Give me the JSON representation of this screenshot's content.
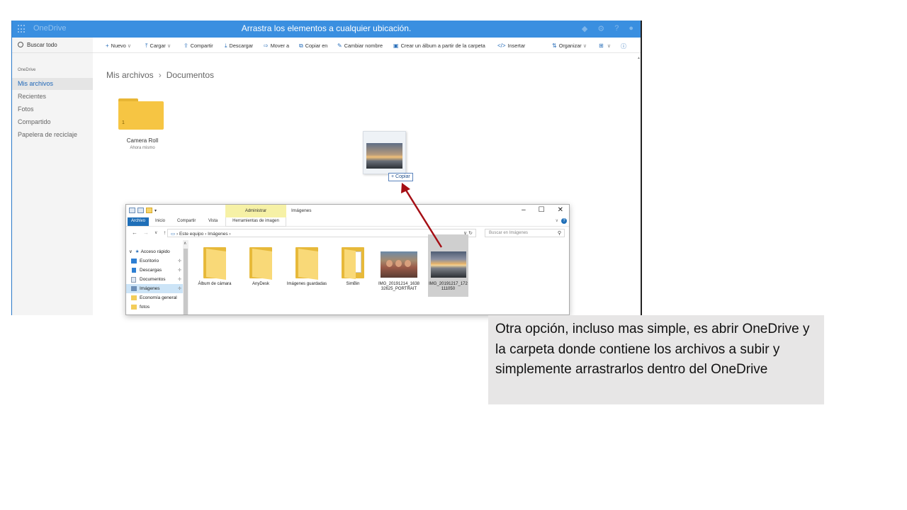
{
  "onedrive": {
    "brand": "OneDrive",
    "drag_message": "Arrastra los elementos a cualquier ubicación.",
    "search_placeholder": "Buscar todo",
    "side_label": "OneDrive",
    "nav": [
      {
        "label": "Mis archivos",
        "active": true
      },
      {
        "label": "Recientes",
        "active": false
      },
      {
        "label": "Fotos",
        "active": false
      },
      {
        "label": "Compartido",
        "active": false
      },
      {
        "label": "Papelera de reciclaje",
        "active": false
      }
    ],
    "commands": {
      "nuevo": "Nuevo",
      "cargar": "Cargar",
      "compartir": "Compartir",
      "descargar": "Descargar",
      "mover": "Mover a",
      "copiar": "Copiar en",
      "cambiar": "Cambiar nombre",
      "album": "Crear un álbum a partir de la carpeta",
      "insertar": "Insertar",
      "organizar": "Organizar"
    },
    "breadcrumb": [
      "Mis archivos",
      "Documentos"
    ],
    "folder": {
      "name": "Camera Roll",
      "subtitle": "Ahora mismo",
      "count": "1"
    },
    "drag_tooltip": "Copiar"
  },
  "explorer": {
    "admin_tab": "Administrar",
    "title": "Imágenes",
    "ribbon": {
      "archivo": "Archivo",
      "inicio": "Inicio",
      "compartir": "Compartir",
      "vista": "Vista",
      "herramientas": "Herramientas de imagen"
    },
    "path": [
      "Este equipo",
      "Imágenes"
    ],
    "search_placeholder": "Buscar en Imágenes",
    "nav_header": "Acceso rápido",
    "nav": [
      {
        "label": "Escritorio",
        "icon": "desktop-icon",
        "color": "#2d7fd3"
      },
      {
        "label": "Descargas",
        "icon": "download-icon",
        "color": "#2d7fd3"
      },
      {
        "label": "Documentos",
        "icon": "document-icon",
        "color": "#dfe8f3"
      },
      {
        "label": "Imágenes",
        "icon": "pictures-icon",
        "color": "#6c8fb8"
      },
      {
        "label": "Economía general",
        "icon": "folder-icon",
        "color": "#f3cd5a"
      },
      {
        "label": "fotos",
        "icon": "folder-icon",
        "color": "#f3cd5a"
      }
    ],
    "items": [
      {
        "label": "Álbum de cámara",
        "type": "folder"
      },
      {
        "label": "AnyDesk",
        "type": "folder"
      },
      {
        "label": "Imágenes guardadas",
        "type": "folder"
      },
      {
        "label": "SimBin",
        "type": "folder-papers"
      },
      {
        "label": "IMG_20191214_163832625_PORTRAIT",
        "type": "photo-people"
      },
      {
        "label": "IMG_20191217_172111050",
        "type": "photo-sunset",
        "selected": true
      }
    ]
  },
  "note": "Otra opción, incluso mas simple, es abrir OneDrive y la carpeta donde contiene los archivos a subir y simplemente arrastrarlos dentro del OneDrive",
  "colors": {
    "onedrive_blue": "#3a8fe0",
    "folder_yellow": "#f6c543",
    "arrow_red": "#a50f15",
    "note_bg": "#e7e6e6"
  }
}
